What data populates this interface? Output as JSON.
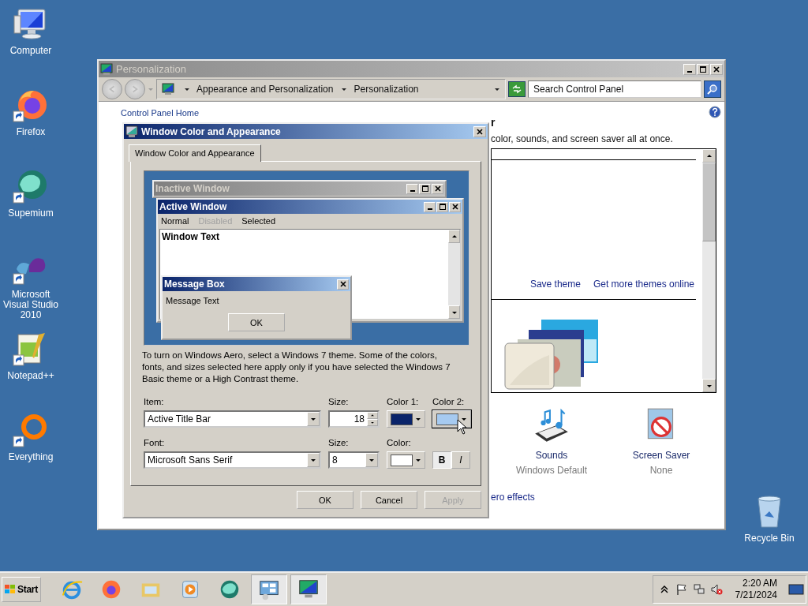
{
  "desktop_icons": [
    {
      "label": "Computer",
      "kind": "computer",
      "shortcut": false
    },
    {
      "label": "Firefox",
      "kind": "firefox",
      "shortcut": true
    },
    {
      "label": "Supemium",
      "kind": "supemium",
      "shortcut": true
    },
    {
      "label": "Microsoft Visual Studio 2010",
      "kind": "visualstudio",
      "shortcut": true
    },
    {
      "label": "Notepad++",
      "kind": "notepad",
      "shortcut": true
    },
    {
      "label": "Everything",
      "kind": "everything",
      "shortcut": true
    }
  ],
  "recycle_bin": {
    "label": "Recycle Bin"
  },
  "personalization_window": {
    "title": "Personalization",
    "breadcrumb": [
      "Appearance and Personalization",
      "Personalization"
    ],
    "search": {
      "placeholder": "Search Control Panel"
    },
    "nav_link": "Control Panel Home",
    "heading": "r",
    "description": "color, sounds, and screen saver all at once.",
    "theme_links": [
      "Save theme",
      "Get more themes online"
    ],
    "settings": [
      {
        "label": "Sounds",
        "value": "Windows Default",
        "kind": "sounds"
      },
      {
        "label": "Screen Saver",
        "value": "None",
        "kind": "screensaver"
      }
    ],
    "footer_link": "ero effects"
  },
  "dialog": {
    "title": "Window Color and Appearance",
    "tabs": [
      {
        "label": "Window Color and Appearance",
        "selected": true
      }
    ],
    "preview": {
      "inactive_title": "Inactive Window",
      "active_title": "Active Window",
      "menu": [
        {
          "label": "Normal",
          "disabled": false
        },
        {
          "label": "Disabled",
          "disabled": true
        },
        {
          "label": "Selected",
          "disabled": false
        }
      ],
      "window_text": "Window Text",
      "message_title": "Message Box",
      "message_text": "Message Text",
      "message_button": "OK"
    },
    "note": "To turn on Windows Aero, select a Windows 7 theme.  Some of the colors, fonts, and sizes selected here apply only if you have selected the Windows 7 Basic theme or a High Contrast theme.",
    "item": {
      "label": "Item:",
      "value": "Active Title Bar"
    },
    "item_size": {
      "label": "Size:",
      "value": "18"
    },
    "color1": {
      "label": "Color 1:",
      "color": "#0a246a"
    },
    "color2": {
      "label": "Color 2:",
      "color": "#a6caf0"
    },
    "font": {
      "label": "Font:",
      "value": "Microsoft Sans Serif"
    },
    "font_size": {
      "label": "Size:",
      "value": "8"
    },
    "font_color": {
      "label": "Color:",
      "color": "#ffffff"
    },
    "bold": {
      "label": "B",
      "on": true
    },
    "italic": {
      "label": "I",
      "on": false
    },
    "buttons": [
      {
        "label": "OK",
        "disabled": false
      },
      {
        "label": "Cancel",
        "disabled": false
      },
      {
        "label": "Apply",
        "disabled": true
      }
    ]
  },
  "taskbar": {
    "start": "Start",
    "apps": [
      {
        "kind": "ie",
        "active": false
      },
      {
        "kind": "firefox",
        "active": false
      },
      {
        "kind": "folder",
        "active": false
      },
      {
        "kind": "media",
        "active": false
      },
      {
        "kind": "supemium",
        "active": false
      },
      {
        "kind": "controlpanel",
        "active": true
      },
      {
        "kind": "personalization",
        "active": true
      }
    ],
    "time": "2:20 AM",
    "date": "7/21/2024"
  }
}
